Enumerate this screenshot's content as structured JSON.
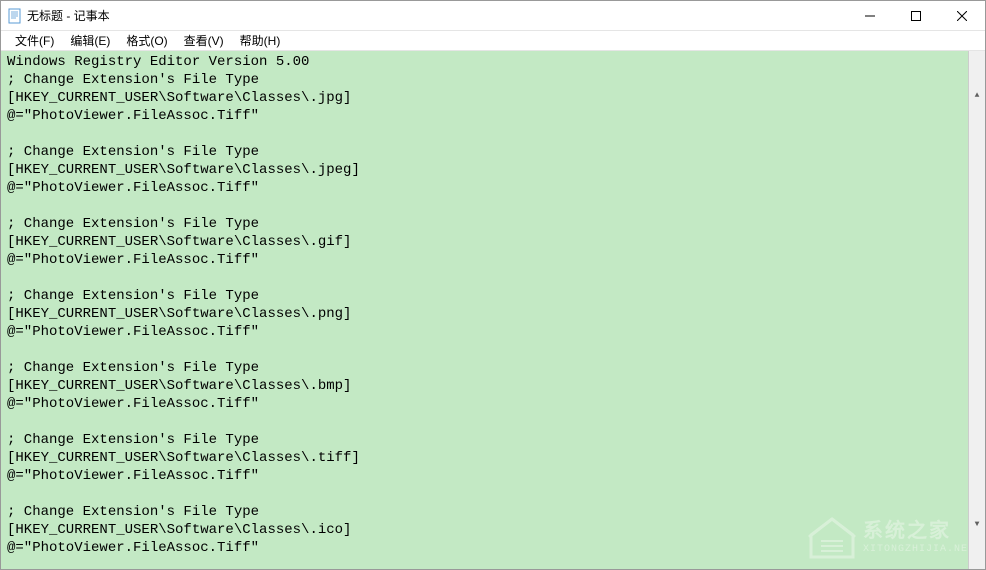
{
  "window": {
    "title": "无标题 - 记事本"
  },
  "menus": {
    "file": "文件(F)",
    "edit": "编辑(E)",
    "format": "格式(O)",
    "view": "查看(V)",
    "help": "帮助(H)"
  },
  "watermark": {
    "cn": "系统之家",
    "en": "XITONGZHIJIA.NET"
  },
  "editorContent": "Windows Registry Editor Version 5.00\n; Change Extension's File Type\n[HKEY_CURRENT_USER\\Software\\Classes\\.jpg]\n@=\"PhotoViewer.FileAssoc.Tiff\"\n\n; Change Extension's File Type\n[HKEY_CURRENT_USER\\Software\\Classes\\.jpeg]\n@=\"PhotoViewer.FileAssoc.Tiff\"\n\n; Change Extension's File Type\n[HKEY_CURRENT_USER\\Software\\Classes\\.gif]\n@=\"PhotoViewer.FileAssoc.Tiff\"\n\n; Change Extension's File Type\n[HKEY_CURRENT_USER\\Software\\Classes\\.png]\n@=\"PhotoViewer.FileAssoc.Tiff\"\n\n; Change Extension's File Type\n[HKEY_CURRENT_USER\\Software\\Classes\\.bmp]\n@=\"PhotoViewer.FileAssoc.Tiff\"\n\n; Change Extension's File Type\n[HKEY_CURRENT_USER\\Software\\Classes\\.tiff]\n@=\"PhotoViewer.FileAssoc.Tiff\"\n\n; Change Extension's File Type\n[HKEY_CURRENT_USER\\Software\\Classes\\.ico]\n@=\"PhotoViewer.FileAssoc.Tiff\""
}
